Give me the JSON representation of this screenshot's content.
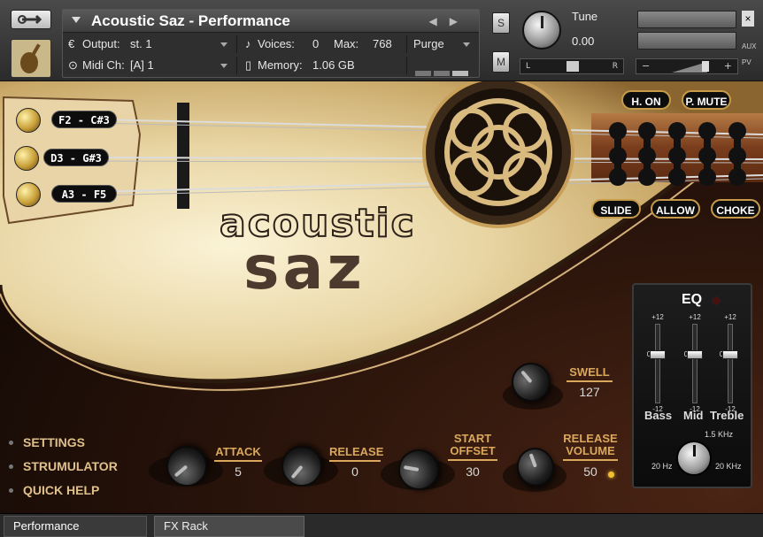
{
  "header": {
    "instrument_title": "Acoustic Saz - Performance",
    "output_label": "Output:",
    "output_value": "st. 1",
    "voices_label": "Voices:",
    "voices_value": "0",
    "max_label": "Max:",
    "max_value": "768",
    "purge_label": "Purge",
    "midi_label": "Midi Ch:",
    "midi_value": "[A] 1",
    "memory_label": "Memory:",
    "memory_value": "1.06 GB",
    "solo_label": "S",
    "mute_label": "M",
    "tune_label": "Tune",
    "tune_value": "0.00",
    "pan_left": "L",
    "pan_right": "R",
    "vol_minus": "−",
    "vol_plus": "+",
    "aux_label": "AUX",
    "pv_label": "PV"
  },
  "strings": [
    {
      "label": "F2 - C#3"
    },
    {
      "label": "D3 - G#3"
    },
    {
      "label": "A3 - F5"
    }
  ],
  "technique_buttons": {
    "h_on": "H. ON",
    "p_mute": "P. MUTE",
    "slide": "SLIDE",
    "allow": "ALLOW",
    "choke": "CHOKE"
  },
  "logo": {
    "line1": "acoustic",
    "line2": "saz"
  },
  "controls": {
    "swell": {
      "label": "SWELL",
      "value": "127"
    },
    "attack": {
      "label": "ATTACK",
      "value": "5"
    },
    "release": {
      "label": "RELEASE",
      "value": "0"
    },
    "start_offset": {
      "label_line1": "START",
      "label_line2": "OFFSET",
      "value": "30"
    },
    "release_volume": {
      "label_line1": "RELEASE",
      "label_line2": "VOLUME",
      "value": "50"
    }
  },
  "side_menu": [
    {
      "label": "SETTINGS"
    },
    {
      "label": "STRUMULATOR"
    },
    {
      "label": "QUICK HELP"
    }
  ],
  "eq": {
    "title": "EQ",
    "scale_top": "+12",
    "scale_mid": "0",
    "scale_bottom": "-12",
    "bands": [
      {
        "name": "Bass",
        "level": 0
      },
      {
        "name": "Mid",
        "level": 0
      },
      {
        "name": "Treble",
        "level": 0
      }
    ],
    "freq_center": "1.5 KHz",
    "freq_min": "20 Hz",
    "freq_max": "20 KHz"
  },
  "footer": {
    "tabs": [
      {
        "label": "Performance",
        "active": true
      },
      {
        "label": "FX Rack",
        "active": false
      }
    ]
  },
  "colors": {
    "accent_gold": "#d9a85c",
    "led_yellow": "#f0c030"
  }
}
